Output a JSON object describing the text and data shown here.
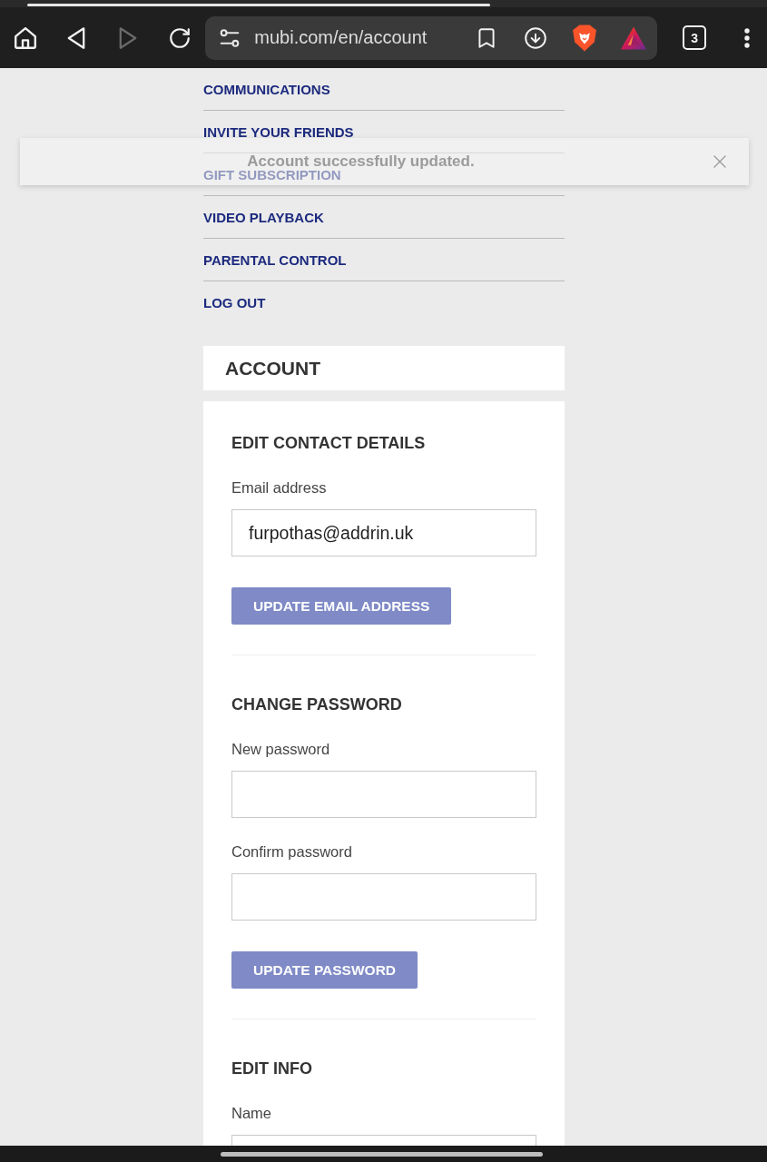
{
  "browser": {
    "url": "mubi.com/en/account",
    "tab_count": "3",
    "forward_disabled": true
  },
  "account_menu": {
    "items": [
      {
        "label": "COMMUNICATIONS"
      },
      {
        "label": "INVITE YOUR FRIENDS"
      },
      {
        "label": "GIFT SUBSCRIPTION"
      },
      {
        "label": "VIDEO PLAYBACK"
      },
      {
        "label": "PARENTAL CONTROL"
      },
      {
        "label": "LOG OUT"
      }
    ]
  },
  "toast": {
    "message": "Account successfully updated."
  },
  "page_title": "ACCOUNT",
  "sections": [
    {
      "title": "EDIT CONTACT DETAILS",
      "fields": [
        {
          "label": "Email address",
          "value": "furpothas@addrin.uk"
        }
      ],
      "button": "UPDATE EMAIL ADDRESS"
    },
    {
      "title": "CHANGE PASSWORD",
      "fields": [
        {
          "label": "New password"
        },
        {
          "label": "Confirm password"
        }
      ],
      "button": "UPDATE PASSWORD"
    },
    {
      "title": "EDIT INFO",
      "fields": [
        {
          "label": "Name"
        }
      ]
    }
  ]
}
